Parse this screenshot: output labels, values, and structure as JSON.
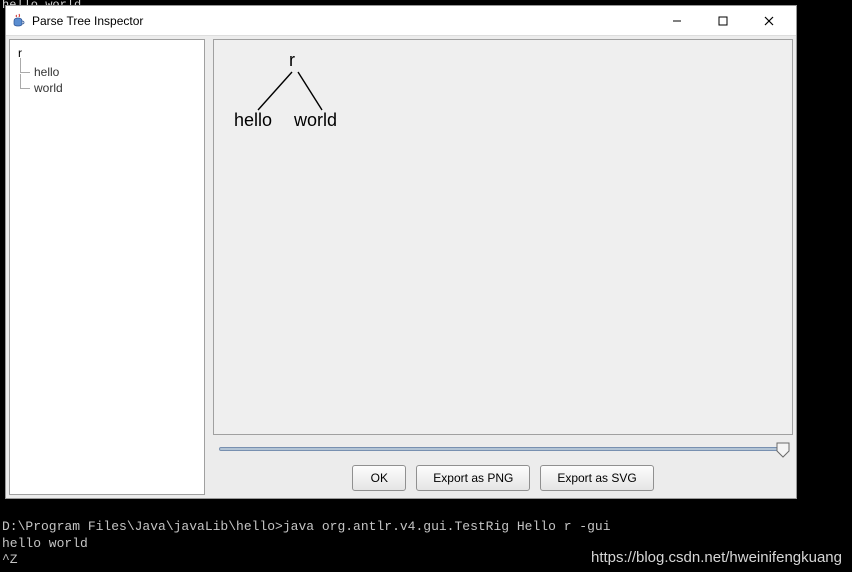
{
  "top_clip_text": "hello world",
  "window": {
    "title": "Parse Tree Inspector"
  },
  "tree": {
    "root": "r",
    "children": [
      "hello",
      "world"
    ]
  },
  "parse_tree": {
    "root": "r",
    "left_child": "hello",
    "right_child": "world"
  },
  "buttons": {
    "ok": "OK",
    "export_png": "Export as PNG",
    "export_svg": "Export as SVG"
  },
  "terminal": {
    "line1": "D:\\Program Files\\Java\\javaLib\\hello>java org.antlr.v4.gui.TestRig Hello r -gui",
    "line2": "hello world",
    "line3": "^Z"
  },
  "watermark": "https://blog.csdn.net/hweinifengkuang"
}
